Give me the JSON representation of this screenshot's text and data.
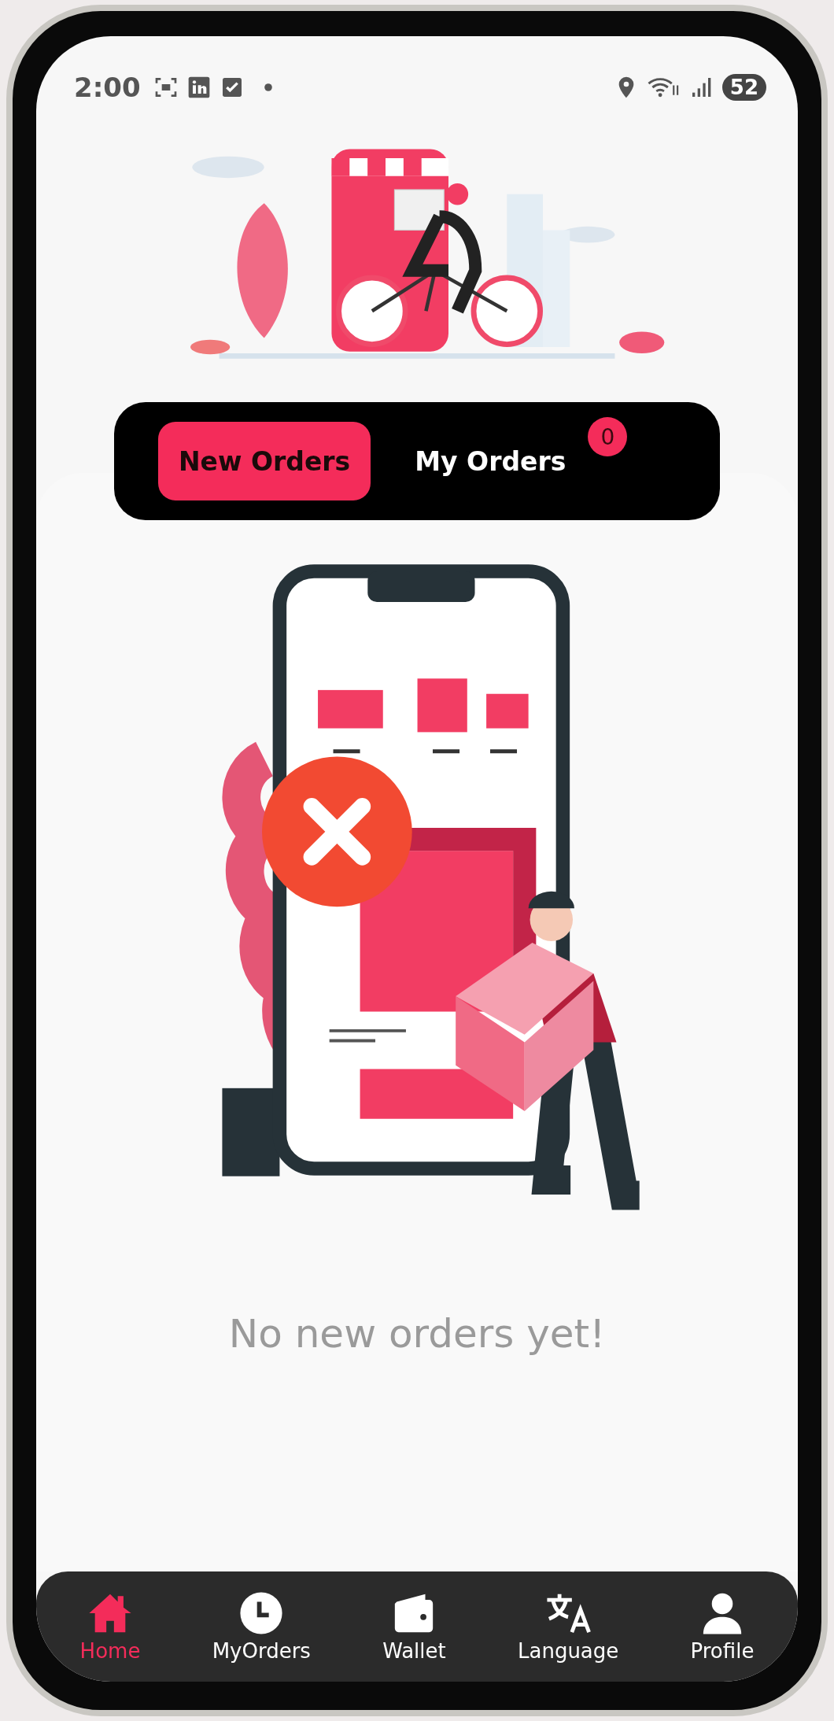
{
  "status_bar": {
    "time": "2:00",
    "battery": "52"
  },
  "tabs": [
    {
      "label": "New Orders",
      "selected": true
    },
    {
      "label": "My Orders",
      "selected": false,
      "badge": "0"
    }
  ],
  "empty_state": {
    "message": "No new orders yet!"
  },
  "bottom_nav": [
    {
      "label": "Home",
      "kind": "home",
      "selected": true
    },
    {
      "label": "MyOrders",
      "kind": "orders",
      "selected": false
    },
    {
      "label": "Wallet",
      "kind": "wallet",
      "selected": false
    },
    {
      "label": "Language",
      "kind": "language",
      "selected": false
    },
    {
      "label": "Profile",
      "kind": "profile",
      "selected": false
    }
  ]
}
